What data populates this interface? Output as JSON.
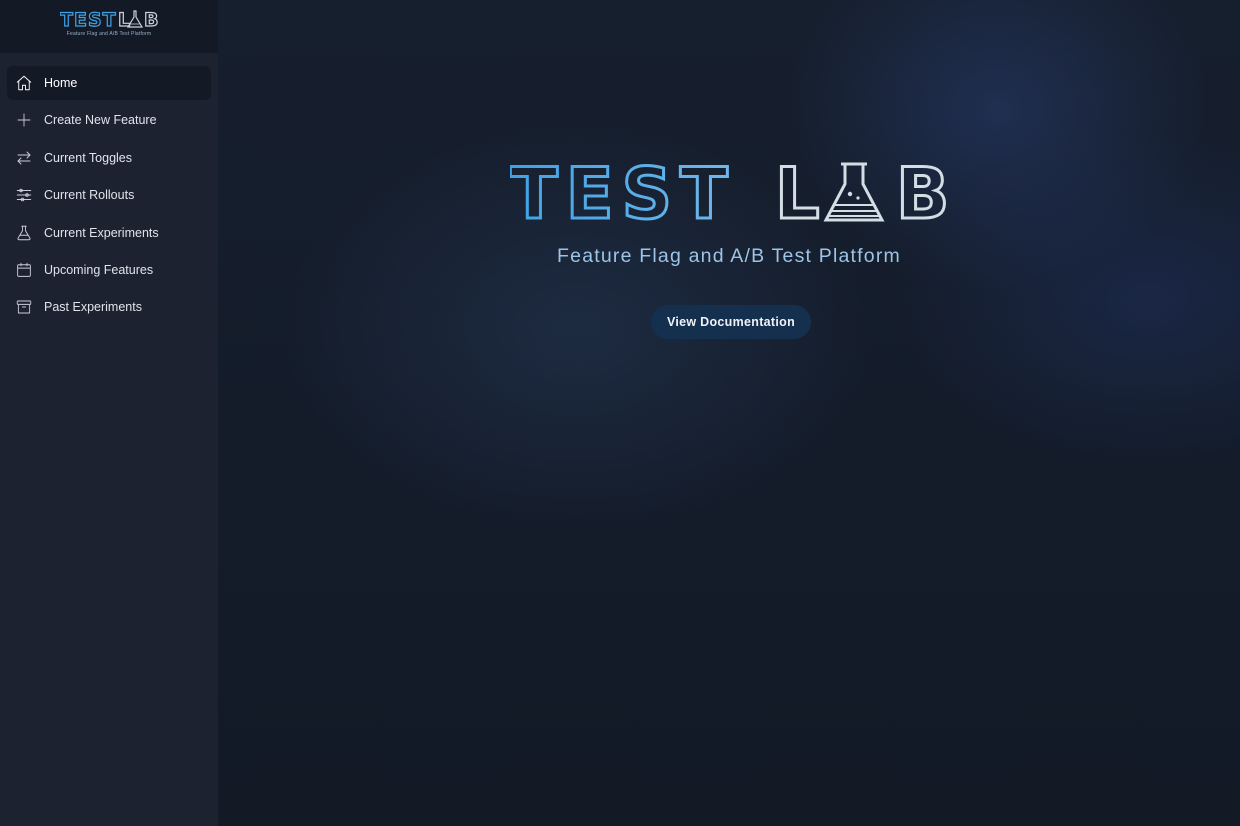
{
  "brand": {
    "logo_text": "TEST LAB",
    "tagline": "Feature Flag and A/B Test Platform"
  },
  "sidebar": {
    "items": [
      {
        "label": "Home",
        "icon": "home-icon",
        "active": true
      },
      {
        "label": "Create New Feature",
        "icon": "plus-icon",
        "active": false
      },
      {
        "label": "Current Toggles",
        "icon": "arrows-exchange-icon",
        "active": false
      },
      {
        "label": "Current Rollouts",
        "icon": "sliders-icon",
        "active": false
      },
      {
        "label": "Current Experiments",
        "icon": "flask-icon",
        "active": false
      },
      {
        "label": "Upcoming Features",
        "icon": "calendar-icon",
        "active": false
      },
      {
        "label": "Past Experiments",
        "icon": "archive-icon",
        "active": false
      }
    ]
  },
  "hero": {
    "logo_text": "TEST LAB",
    "subtitle": "Feature Flag and A/B Test Platform",
    "cta_label": "View Documentation"
  },
  "colors": {
    "background": "#131a26",
    "sidebar": "#1d2230",
    "logo_blue": "#3fa2e6",
    "logo_light": "#d3dde4",
    "subtitle": "#9dc4e6",
    "button": "#15304e"
  }
}
